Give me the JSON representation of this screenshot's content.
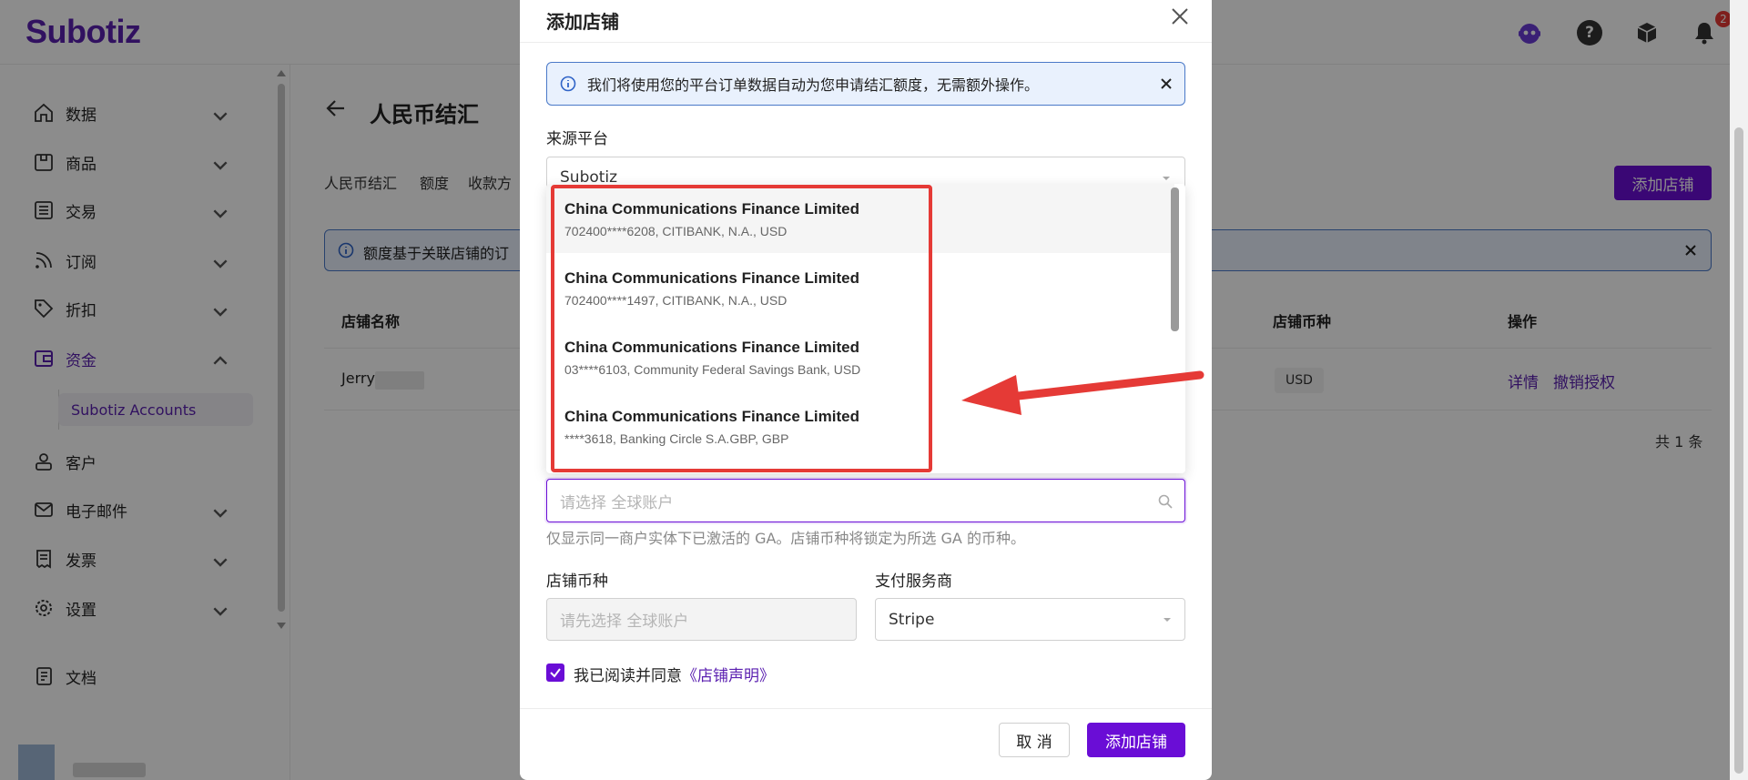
{
  "header": {
    "logo": "Subotiz",
    "notifications_count": "2"
  },
  "sidebar": {
    "items": [
      {
        "label": "数据"
      },
      {
        "label": "商品"
      },
      {
        "label": "交易"
      },
      {
        "label": "订阅"
      },
      {
        "label": "折扣"
      },
      {
        "label": "资金"
      },
      {
        "label": "客户"
      },
      {
        "label": "电子邮件"
      },
      {
        "label": "发票"
      },
      {
        "label": "设置"
      },
      {
        "label": "文档"
      }
    ],
    "sub_item": "Subotiz Accounts"
  },
  "main": {
    "title": "人民币结汇",
    "tabs": [
      "人民币结汇",
      "额度",
      "收款方"
    ],
    "add_store_button": "添加店铺",
    "info_text": "额度基于关联店铺的订",
    "table": {
      "headers": [
        "店铺名称",
        "店铺币种",
        "操作"
      ],
      "rows": [
        {
          "store_name": "Jerry",
          "currency": "USD",
          "actions": [
            "详情",
            "撤销授权"
          ]
        }
      ]
    },
    "total": "共 1 条"
  },
  "modal": {
    "title": "添加店铺",
    "info": "我们将使用您的平台订单数据自动为您申请结汇额度，无需额外操作。",
    "source_platform_label": "来源平台",
    "source_platform_value": "Subotiz",
    "accounts": [
      {
        "name": "China Communications Finance Limited",
        "detail": "702400****6208, CITIBANK, N.A., USD"
      },
      {
        "name": "China Communications Finance Limited",
        "detail": "702400****1497, CITIBANK, N.A., USD"
      },
      {
        "name": "China Communications Finance Limited",
        "detail": "03****6103, Community Federal Savings Bank, USD"
      },
      {
        "name": "China Communications Finance Limited",
        "detail": "****3618, Banking Circle S.A.GBP, GBP"
      }
    ],
    "ga_placeholder": "请选择 全球账户",
    "helper": "仅显示同一商户实体下已激活的 GA。店铺币种将锁定为所选 GA 的币种。",
    "store_currency_label": "店铺币种",
    "store_currency_placeholder": "请先选择 全球账户",
    "payment_provider_label": "支付服务商",
    "payment_provider_value": "Stripe",
    "agree_text": "我已阅读并同意",
    "agree_link": "《店铺声明》",
    "cancel_button": "取 消",
    "submit_button": "添加店铺"
  },
  "colors": {
    "brand": "#6a0dd6",
    "annotation": "#e53a36"
  }
}
